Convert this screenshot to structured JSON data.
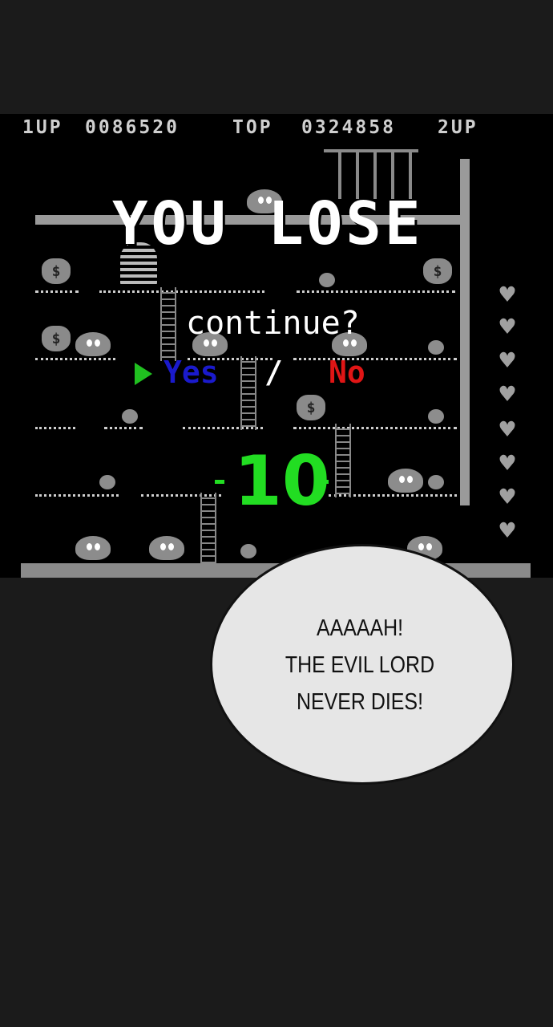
{
  "hud": {
    "p1_label": "1UP",
    "p1_score": "0086520",
    "top_label": "TOP",
    "top_score": "0324858",
    "p2_label": "2UP"
  },
  "screen": {
    "title": "YOU LOSE",
    "prompt": "continue?",
    "option_yes": "Yes",
    "separator": "/",
    "option_no": "No",
    "countdown": "10"
  },
  "colors": {
    "yes": "#1a1acc",
    "no": "#e01515",
    "countdown": "#22dd22",
    "cursor": "#20c020"
  },
  "lives_remaining_hearts": 8,
  "speech_bubble": {
    "line1": "AAAAAH!",
    "line2": "THE EVIL LORD",
    "line3": "NEVER DIES!"
  }
}
